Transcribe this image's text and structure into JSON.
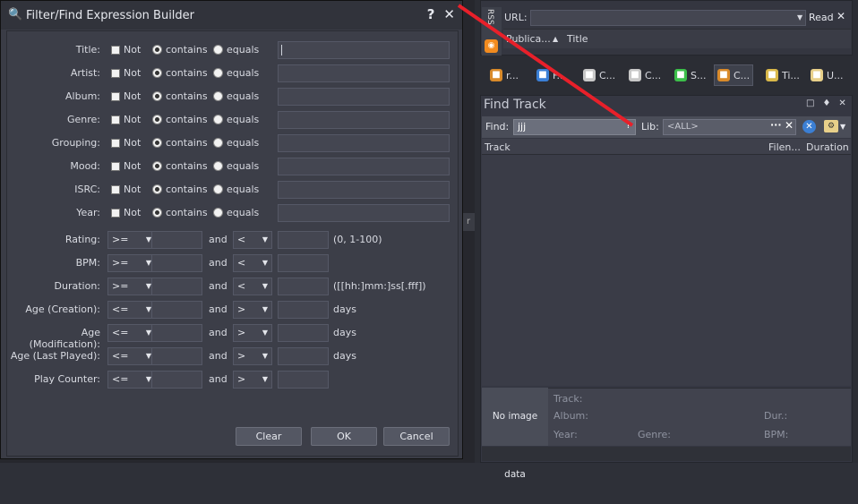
{
  "dialog": {
    "title": "Filter/Find Expression Builder",
    "help_label": "?",
    "close_label": "✕",
    "text_rows": [
      {
        "label": "Title:"
      },
      {
        "label": "Artist:"
      },
      {
        "label": "Album:"
      },
      {
        "label": "Genre:"
      },
      {
        "label": "Grouping:"
      },
      {
        "label": "Mood:"
      },
      {
        "label": "ISRC:"
      },
      {
        "label": "Year:"
      }
    ],
    "not_label": "Not",
    "contains_label": "contains",
    "equals_label": "equals",
    "and_label": "and",
    "range_rows": [
      {
        "label": "Rating:",
        "op1": ">=",
        "op2": "<",
        "suffix": "(0, 1-100)"
      },
      {
        "label": "BPM:",
        "op1": ">=",
        "op2": "<",
        "suffix": ""
      },
      {
        "label": "Duration:",
        "op1": ">=",
        "op2": "<",
        "suffix": "([[hh:]mm:]ss[.fff])"
      },
      {
        "label": "Age (Creation):",
        "op1": "<=",
        "op2": ">",
        "suffix": "days"
      },
      {
        "label": "Age (Modification):",
        "op1": "<=",
        "op2": ">",
        "suffix": "days"
      },
      {
        "label": "Age (Last Played):",
        "op1": "<=",
        "op2": ">",
        "suffix": "days"
      },
      {
        "label": "Play Counter:",
        "op1": "<=",
        "op2": ">",
        "suffix": ""
      }
    ],
    "buttons": {
      "clear": "Clear",
      "ok": "OK",
      "cancel": "Cancel"
    }
  },
  "rss": {
    "tab_label": "RSS",
    "url_label": "URL:",
    "read_label": "Read",
    "close_label": "✕",
    "col_published": "Publica...",
    "col_title": "Title"
  },
  "tabs": [
    {
      "label": "r...",
      "icon": "home-icon",
      "color": "#d98a2a"
    },
    {
      "label": "F...",
      "icon": "globe-icon",
      "color": "#3a7fd6"
    },
    {
      "label": "C...",
      "icon": "card-icon",
      "color": "#c8c8c8"
    },
    {
      "label": "C...",
      "icon": "card-add-icon",
      "color": "#c8c8c8"
    },
    {
      "label": "S...",
      "icon": "signal-icon",
      "color": "#3cbf4a"
    },
    {
      "label": "C...",
      "icon": "home-settings-icon",
      "color": "#d98a2a"
    },
    {
      "label": "Ti...",
      "icon": "hourglass-icon",
      "color": "#d9b84a"
    },
    {
      "label": "U...",
      "icon": "note-icon",
      "color": "#e8d08a"
    }
  ],
  "find": {
    "title": "Find Track",
    "find_label": "Find:",
    "find_value": "jjj",
    "help_label": "?",
    "lib_label": "Lib:",
    "lib_value": "<ALL>",
    "dots_label": "···",
    "close_label": "✕",
    "col_track": "Track",
    "col_filename": "Filen...",
    "col_duration": "Duration",
    "no_image": "No image data",
    "info": {
      "track": "Track:",
      "album": "Album:",
      "dur": "Dur.:",
      "year": "Year:",
      "genre": "Genre:",
      "bpm": "BPM:"
    }
  },
  "misc": {
    "side_chip": "r"
  },
  "colors": {
    "annotation": "#e8202a",
    "rss_orange": "#f28b1f",
    "clear_blue": "#3b7fd4"
  }
}
